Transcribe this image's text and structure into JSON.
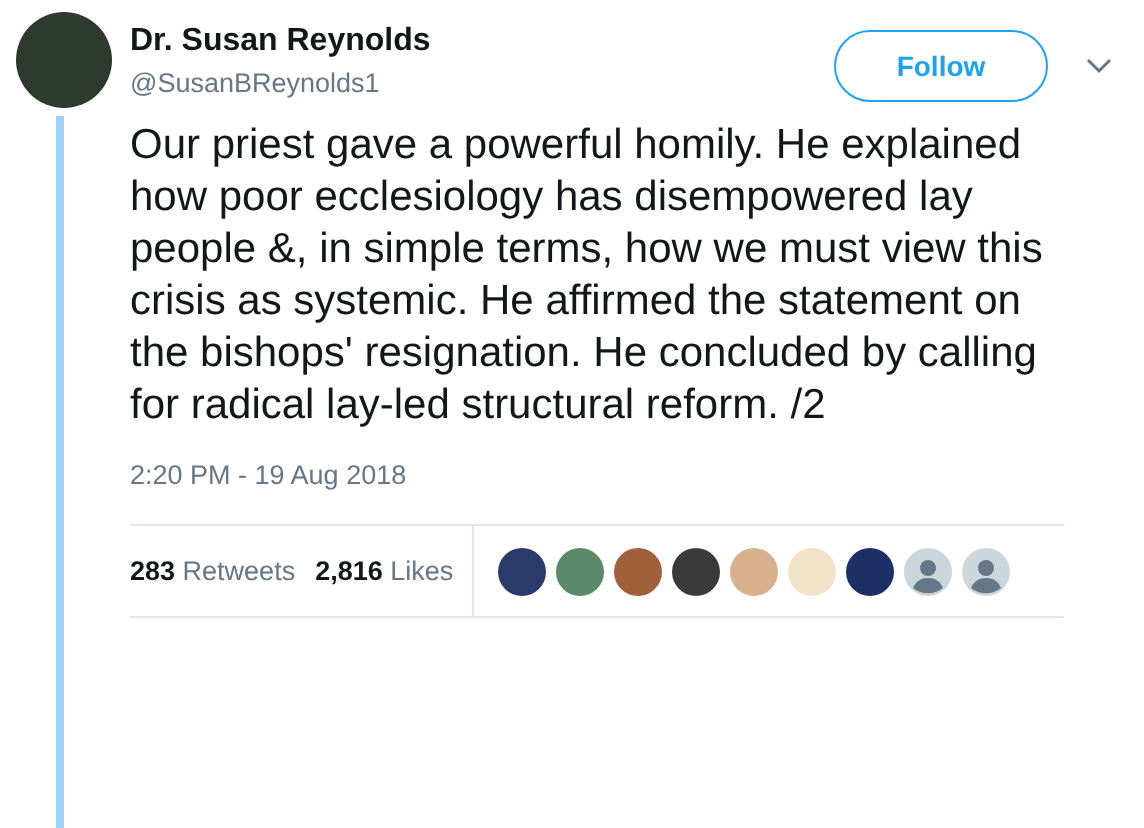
{
  "author": {
    "name": "Dr. Susan Reynolds",
    "handle": "@SusanBReynolds1"
  },
  "follow_button": {
    "label": "Follow"
  },
  "tweet_text": "Our priest gave a powerful homily. He explained how poor ecclesiology has disempowered lay people &, in simple terms, how we must view this crisis as systemic. He affirmed the statement on the bishops' resignation. He concluded by calling for radical lay-led structural reform. /2",
  "timestamp": "2:20 PM - 19 Aug 2018",
  "stats": [
    {
      "count": "283",
      "label": "Retweets"
    },
    {
      "count": "2,816",
      "label": "Likes"
    }
  ],
  "likers": [
    {
      "kind": "photo"
    },
    {
      "kind": "photo"
    },
    {
      "kind": "photo"
    },
    {
      "kind": "photo"
    },
    {
      "kind": "photo"
    },
    {
      "kind": "photo"
    },
    {
      "kind": "photo"
    },
    {
      "kind": "default"
    },
    {
      "kind": "default"
    }
  ]
}
